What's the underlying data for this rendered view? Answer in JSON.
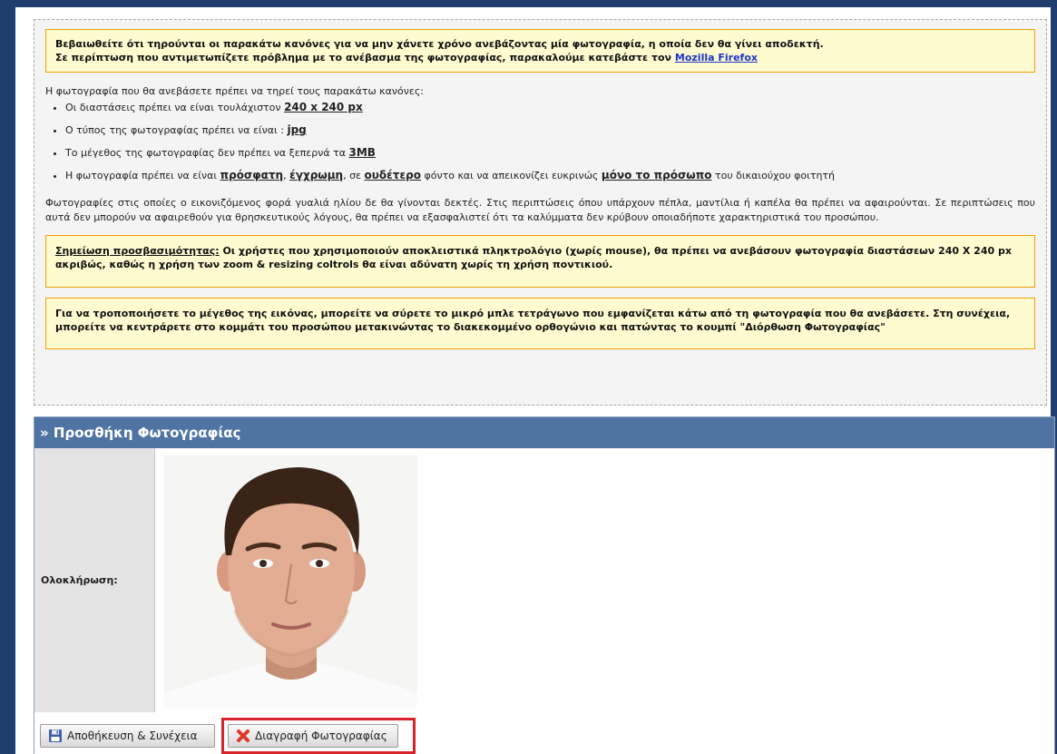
{
  "info": {
    "warning_line1": "Βεβαιωθείτε ότι τηρούνται οι παρακάτω κανόνες για να μην χάνετε χρόνο ανεβάζοντας μία φωτογραφία, η οποία δεν θα γίνει αποδεκτή.",
    "warning_line2": "Σε περίπτωση που αντιμετωπίζετε πρόβλημα με το ανέβασμα της φωτογραφίας, παρακαλούμε κατεβάστε τον ",
    "warning_link": "Mozilla Firefox",
    "rules_intro": "Η φωτογραφία που θα ανεβάσετε πρέπει να τηρεί τους παρακάτω κανόνες:",
    "rule1_text": "Οι διαστάσεις πρέπει να είναι τουλάχιστον ",
    "rule1_value": "240 x 240 px",
    "rule2_text": "Ο τύπος της φωτογραφίας πρέπει να είναι : ",
    "rule2_value": "jpg",
    "rule3_text": "Το μέγεθος της φωτογραφίας δεν πρέπει να ξεπερνά τα ",
    "rule3_value": "3MB",
    "rule4_a": "Η φωτογραφία πρέπει να είναι ",
    "rule4_b": "πρόσφατη",
    "rule4_c": ", ",
    "rule4_d": "έγχρωμη",
    "rule4_e": ", σε ",
    "rule4_f": "ουδέτερο",
    "rule4_g": " φόντο και να απεικονίζει ευκρινώς ",
    "rule4_h": "μόνο το πρόσωπο",
    "rule4_i": " του δικαιούχου φοιτητή",
    "paragraph": "Φωτογραφίες στις οποίες ο εικονιζόμενος φορά γυαλιά ηλίου δε θα γίνονται δεκτές. Στις περιπτώσεις όπου υπάρχουν πέπλα, μαντίλια ή καπέλα θα πρέπει να αφαιρούνται. Σε περιπτώσεις που αυτά δεν μπορούν να αφαιρεθούν για θρησκευτικούς λόγους, θα πρέπει να εξασφαλιστεί ότι τα καλύμματα δεν κρύβουν οποιαδήποτε χαρακτηριστικά του προσώπου.",
    "accessibility_label": "Σημείωση προσβασιμότητας:",
    "accessibility_text": " Οι χρήστες που χρησιμοποιούν αποκλειστικά πληκτρολόγιο (χωρίς mouse), θα πρέπει να ανεβάσουν φωτογραφία διαστάσεων 240 Χ 240 px ακριβώς, καθώς η χρήση των zoom & resizing coltrols θα είναι αδύνατη χωρίς τη χρήση ποντικιού.",
    "resize_note": "Για να τροποποιήσετε το μέγεθος της εικόνας, μπορείτε να σύρετε το μικρό μπλε τετράγωνο που εμφανίζεται κάτω από τη φωτογραφία που θα ανεβάσετε. Στη συνέχεια, μπορείτε να κεντράρετε στο κομμάτι του προσώπου μετακινώντας το διακεκομμένο ορθογώνιο και πατώντας το κουμπί \"Διόρθωση Φωτογραφίας\""
  },
  "section": {
    "title": "» Προσθήκη Φωτογραφίας",
    "row_label": "Ολοκλήρωση:"
  },
  "buttons": {
    "save_label": "Αποθήκευση & Συνέχεια",
    "delete_label": "Διαγραφή Φωτογραφίας"
  },
  "colors": {
    "header_bg": "#4f74a3",
    "note_bg": "#fffbd0",
    "note_border": "#f0a000",
    "highlight": "#d9232b"
  }
}
